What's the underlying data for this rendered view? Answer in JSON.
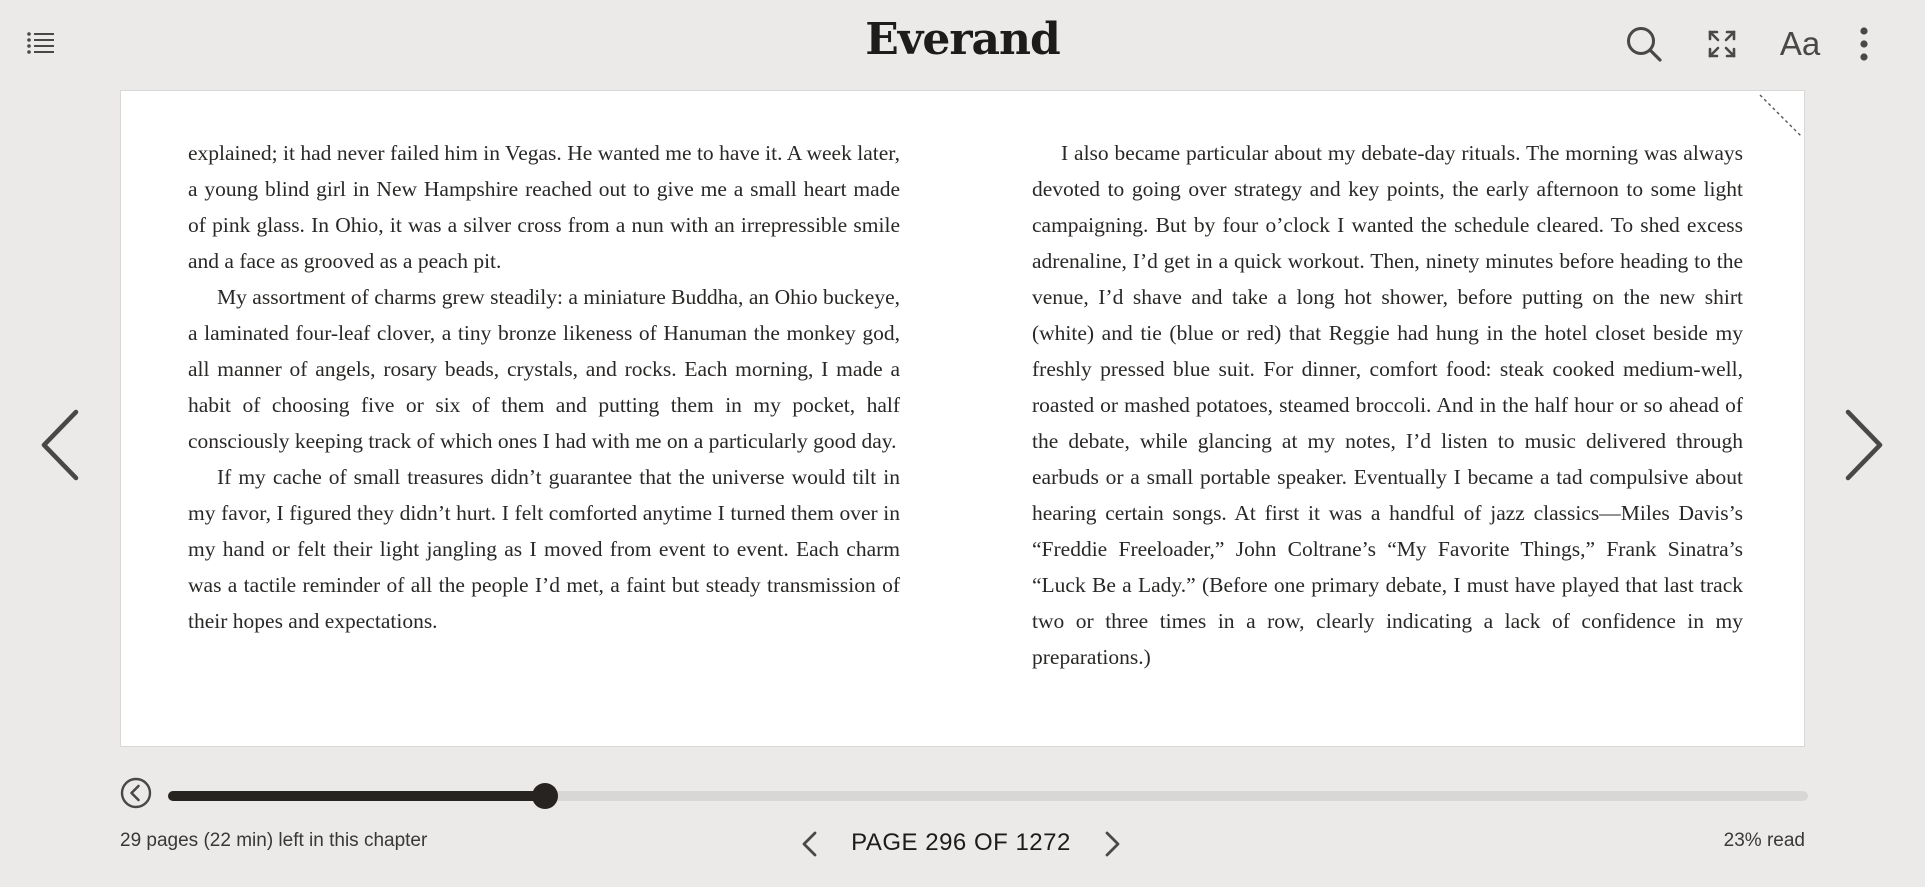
{
  "app": {
    "logo_text": "Everand"
  },
  "toolbar": {
    "toc_icon": "list-icon",
    "search_icon": "search-icon",
    "fullscreen_icon": "fullscreen-icon",
    "font_settings_label": "Aa",
    "more_icon": "more-vertical-icon"
  },
  "book": {
    "left_column": [
      "explained; it had never failed him in Vegas. He wanted me to have it. A week later, a young blind girl in New Hampshire reached out to give me a small heart made of pink glass. In Ohio, it was a silver cross from a nun with an irre­pressible smile and a face as grooved as a peach pit.",
      "My assortment of charms grew steadily: a miniature Buddha, an Ohio buck­eye, a laminated four-leaf clover, a tiny bronze likeness of Hanuman the mon­key god, all manner of angels, rosary beads, crystals, and rocks. Each morning, I made a habit of choosing five or six of them and putting them in my pocket, half consciously keeping track of which ones I had with me on a particularly good day.",
      "If my cache of small treasures didn’t guarantee that the universe would tilt in my favor, I figured they didn’t hurt. I felt comforted anytime I turned them over in my hand or felt their light jangling as I moved from event to event. Each charm was a tactile reminder of all the people I’d met, a faint but steady trans­mission of their hopes and expectations."
    ],
    "right_column": [
      "I also became particular about my debate-day rituals. The morning was al­ways devoted to going over strategy and key points, the early afternoon to some light campaigning. But by four o’clock I wanted the schedule cleared. To shed excess adrenaline, I’d get in a quick workout. Then, ninety minutes before head­ing to the venue, I’d shave and take a long hot shower, before putting on the new shirt (white) and tie (blue or red) that Reggie had hung in the hotel closet beside my freshly pressed blue suit. For dinner, comfort food: steak cooked medium-well, roasted or mashed potatoes, steamed broccoli. And in the half hour or so ahead of the debate, while glancing at my notes, I’d listen to music delivered through earbuds or a small portable speaker. Eventually I became a tad compulsive about hearing certain songs. At first it was a handful of jazz classics—Miles Davis’s “Freddie Freeloader,” John Coltrane’s “My Favorite Things,” Frank Sinatra’s “Luck Be a Lady.” (Before one primary debate, I must have played that last track two or three times in a row, clearly indicating a lack of confidence in my preparations.)"
    ]
  },
  "navigation": {
    "prev_icon": "chevron-left-icon",
    "next_icon": "chevron-right-icon"
  },
  "progress": {
    "back_icon": "history-back-icon",
    "slider_fraction": 0.23,
    "chapter_remaining": "29 pages (22 min) left in this chapter",
    "page_label": "PAGE 296 OF 1272",
    "percent_read": "23% read"
  }
}
